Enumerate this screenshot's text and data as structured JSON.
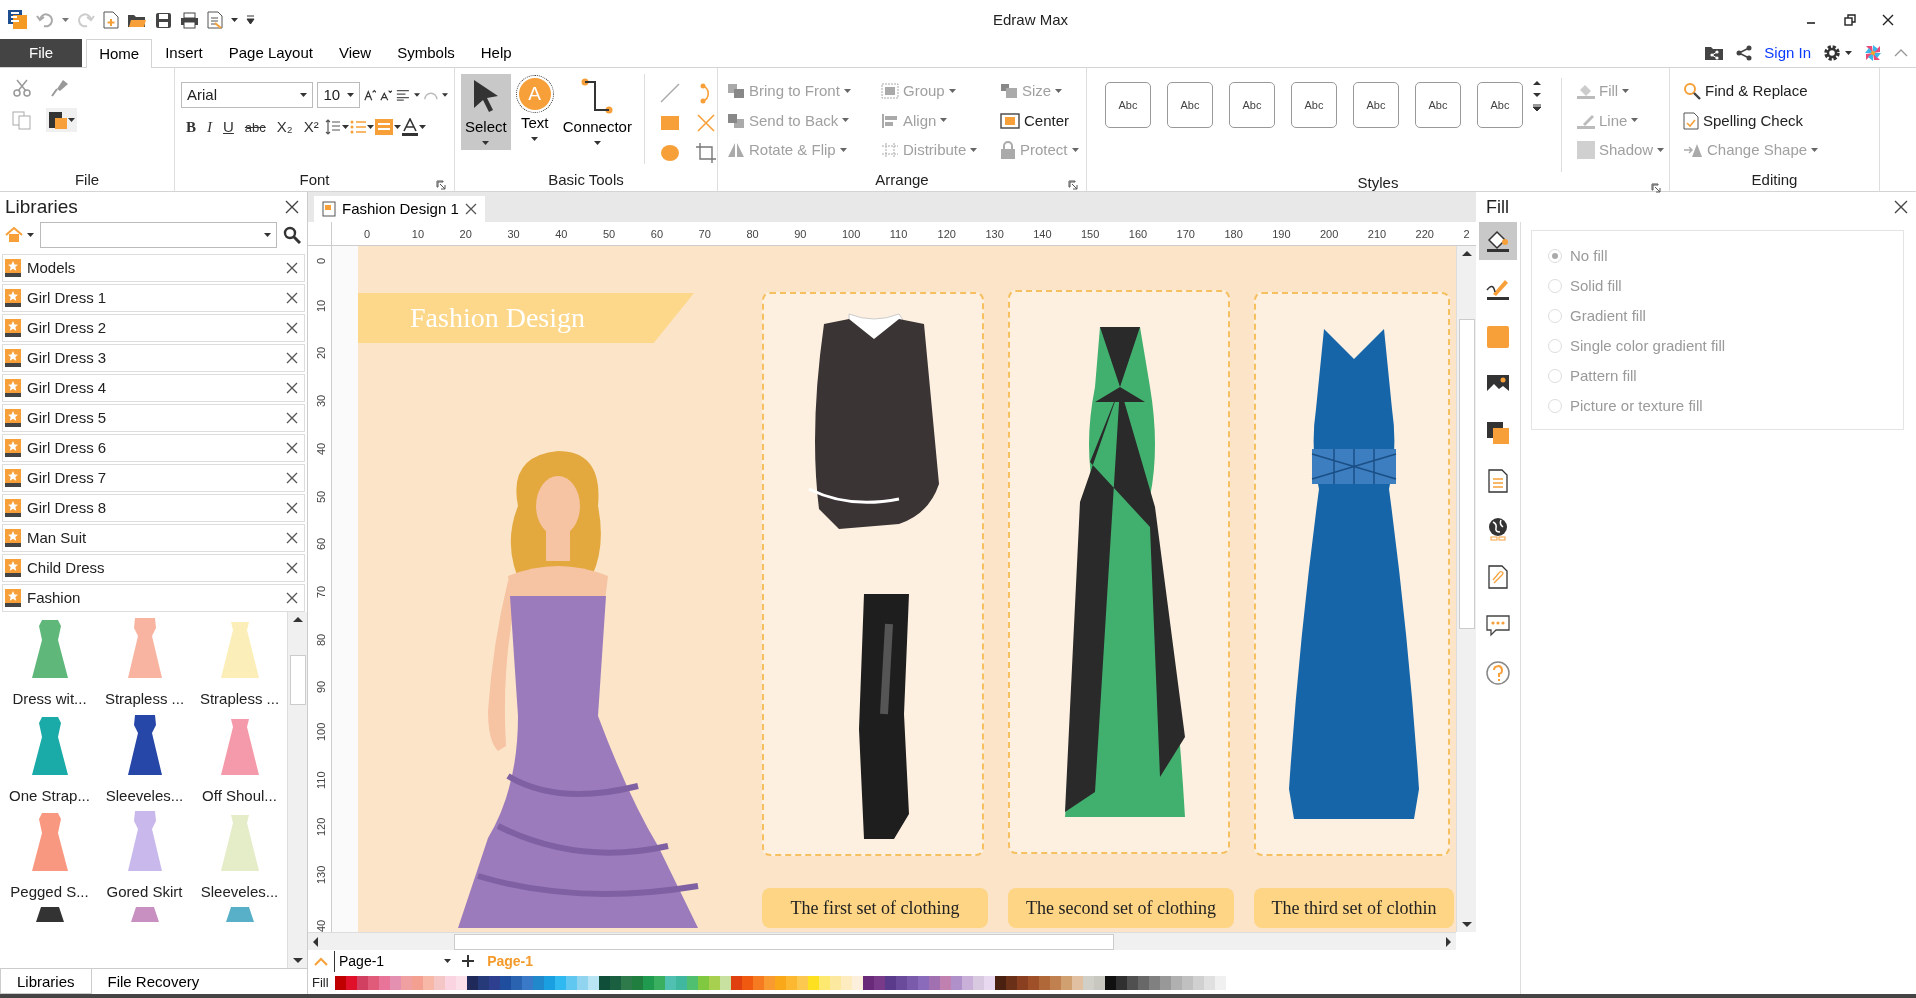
{
  "title_bar": {
    "title": "Edraw Max"
  },
  "menu_tabs": [
    {
      "label": "File",
      "kind": "file",
      "selected": false
    },
    {
      "label": "Home",
      "kind": "tab",
      "selected": true
    },
    {
      "label": "Insert",
      "kind": "tab",
      "selected": false
    },
    {
      "label": "Page Layout",
      "kind": "tab",
      "selected": false
    },
    {
      "label": "View",
      "kind": "tab",
      "selected": false
    },
    {
      "label": "Symbols",
      "kind": "tab",
      "selected": false
    },
    {
      "label": "Help",
      "kind": "tab",
      "selected": false
    }
  ],
  "account": {
    "sign_in": "Sign In"
  },
  "ribbon": {
    "file_group": {
      "label": "File"
    },
    "font_group": {
      "label": "Font",
      "font": "Arial",
      "size": "10",
      "format_buttons": [
        "B",
        "I",
        "U",
        "abc",
        "X₂",
        "X²"
      ]
    },
    "basic_tools": {
      "label": "Basic Tools",
      "tools": [
        {
          "label": "Select",
          "kind": "select",
          "selected": true
        },
        {
          "label": "Text",
          "kind": "text",
          "glyph": "A",
          "selected": false
        },
        {
          "label": "Connector",
          "kind": "connector",
          "selected": false
        }
      ]
    },
    "arrange": {
      "label": "Arrange",
      "items": [
        {
          "label": "Bring to Front",
          "kind": "front",
          "disabled": true,
          "dropdown": true
        },
        {
          "label": "Group",
          "kind": "group",
          "disabled": true,
          "dropdown": true
        },
        {
          "label": "Size",
          "kind": "size",
          "disabled": true,
          "dropdown": true
        },
        {
          "label": "Send to Back",
          "kind": "back",
          "disabled": true,
          "dropdown": true
        },
        {
          "label": "Align",
          "kind": "align",
          "disabled": true,
          "dropdown": true
        },
        {
          "label": "Center",
          "kind": "center",
          "disabled": false,
          "dropdown": false
        },
        {
          "label": "Rotate & Flip",
          "kind": "rotate",
          "disabled": true,
          "dropdown": true
        },
        {
          "label": "Distribute",
          "kind": "distribute",
          "disabled": true,
          "dropdown": true
        },
        {
          "label": "Protect",
          "kind": "protect",
          "disabled": true,
          "dropdown": true
        }
      ]
    },
    "styles": {
      "label": "Styles",
      "swatches": [
        "Abc",
        "Abc",
        "Abc",
        "Abc",
        "Abc",
        "Abc",
        "Abc"
      ],
      "format": [
        {
          "label": "Fill",
          "kind": "fill",
          "disabled": true
        },
        {
          "label": "Line",
          "kind": "line",
          "disabled": true
        },
        {
          "label": "Shadow",
          "kind": "shadow",
          "disabled": true
        }
      ]
    },
    "editing": {
      "label": "Editing",
      "items": [
        {
          "label": "Find & Replace",
          "kind": "find",
          "disabled": false,
          "dropdown": false
        },
        {
          "label": "Spelling Check",
          "kind": "spelling",
          "disabled": false,
          "dropdown": false
        },
        {
          "label": "Change Shape",
          "kind": "shape",
          "disabled": true,
          "dropdown": true
        }
      ]
    }
  },
  "libraries": {
    "title": "Libraries",
    "items": [
      {
        "label": "Models"
      },
      {
        "label": "Girl Dress 1"
      },
      {
        "label": "Girl Dress 2"
      },
      {
        "label": "Girl Dress 3"
      },
      {
        "label": "Girl Dress 4"
      },
      {
        "label": "Girl Dress 5"
      },
      {
        "label": "Girl Dress 6"
      },
      {
        "label": "Girl Dress 7"
      },
      {
        "label": "Girl Dress 8"
      },
      {
        "label": "Man Suit"
      },
      {
        "label": "Child Dress"
      },
      {
        "label": "Fashion"
      }
    ],
    "shapes": [
      {
        "label": "Dress wit..."
      },
      {
        "label": "Strapless ..."
      },
      {
        "label": "Strapless ..."
      },
      {
        "label": "One Strap..."
      },
      {
        "label": "Sleeveles..."
      },
      {
        "label": "Off Shoul..."
      },
      {
        "label": "Pegged S..."
      },
      {
        "label": "Gored Skirt"
      },
      {
        "label": "Sleeveles..."
      }
    ],
    "tabs": [
      {
        "label": "Libraries",
        "selected": true
      },
      {
        "label": "File Recovery",
        "selected": false
      }
    ]
  },
  "document_tab": {
    "title": "Fashion Design 1"
  },
  "rulers": {
    "horizontal": [
      "0",
      "10",
      "20",
      "30",
      "40",
      "50",
      "60",
      "70",
      "80",
      "90",
      "100",
      "110",
      "120",
      "130",
      "140",
      "150",
      "160",
      "170",
      "180",
      "190",
      "200",
      "210",
      "220",
      "2"
    ],
    "vertical": [
      "0",
      "10",
      "20",
      "30",
      "40",
      "50",
      "60",
      "70",
      "80",
      "90",
      "100",
      "110",
      "120",
      "130",
      "40"
    ]
  },
  "canvas": {
    "banner": "Fashion Design",
    "cards": [
      {
        "kind": "top-and-boots",
        "caption": "The first set of clothing"
      },
      {
        "kind": "striped-gown",
        "caption": "The second set of clothing"
      },
      {
        "kind": "blue-gown",
        "caption": "The third set of clothin"
      }
    ]
  },
  "page_bar": {
    "page_select": "Page-1",
    "pages": [
      {
        "label": "Page-1",
        "selected": true
      }
    ]
  },
  "palette": {
    "label": "Fill",
    "swatches": [
      {
        "color": "#c00000"
      },
      {
        "color": "#e0102a"
      },
      {
        "color": "#d14060"
      },
      {
        "color": "#e05a7a"
      },
      {
        "color": "#e8749a"
      },
      {
        "color": "#e490b0"
      },
      {
        "color": "#f0a0a0"
      },
      {
        "color": "#f4a090"
      },
      {
        "color": "#f8b8a8"
      },
      {
        "color": "#f5c6c6"
      },
      {
        "color": "#fad4e0"
      },
      {
        "color": "#fbe0ea"
      },
      {
        "color": "#1f2a5a"
      },
      {
        "color": "#263a7a"
      },
      {
        "color": "#2f3f8f"
      },
      {
        "color": "#1f4e9f"
      },
      {
        "color": "#2a64b0"
      },
      {
        "color": "#3a78c8"
      },
      {
        "color": "#2288cc"
      },
      {
        "color": "#1aa0e0"
      },
      {
        "color": "#30b8f0"
      },
      {
        "color": "#60c8f0"
      },
      {
        "color": "#90d4f0"
      },
      {
        "color": "#b8e4f4"
      },
      {
        "color": "#0f4f3a"
      },
      {
        "color": "#1a5f40"
      },
      {
        "color": "#2e7a4a"
      },
      {
        "color": "#207f3f"
      },
      {
        "color": "#1f9a4f"
      },
      {
        "color": "#3aaf60"
      },
      {
        "color": "#50c0b0"
      },
      {
        "color": "#40b8a0"
      },
      {
        "color": "#50c070"
      },
      {
        "color": "#80c840"
      },
      {
        "color": "#a8d050"
      },
      {
        "color": "#c8e0a0"
      },
      {
        "color": "#e04010"
      },
      {
        "color": "#f05a10"
      },
      {
        "color": "#f57a20"
      },
      {
        "color": "#f89a30"
      },
      {
        "color": "#f8a818"
      },
      {
        "color": "#fbb830"
      },
      {
        "color": "#fcc850"
      },
      {
        "color": "#fde020"
      },
      {
        "color": "#fde870"
      },
      {
        "color": "#fde8a0"
      },
      {
        "color": "#fdecc0"
      },
      {
        "color": "#fcf0dc"
      },
      {
        "color": "#6a2a7a"
      },
      {
        "color": "#7a3a8a"
      },
      {
        "color": "#5a3a8a"
      },
      {
        "color": "#6a4a9a"
      },
      {
        "color": "#7a5aaa"
      },
      {
        "color": "#8a6aba"
      },
      {
        "color": "#a070b0"
      },
      {
        "color": "#c080b0"
      },
      {
        "color": "#b090c8"
      },
      {
        "color": "#c8b0d8"
      },
      {
        "color": "#d8c8e0"
      },
      {
        "color": "#e8d8f0"
      },
      {
        "color": "#4a2010"
      },
      {
        "color": "#6a3018"
      },
      {
        "color": "#8a4020"
      },
      {
        "color": "#a05028"
      },
      {
        "color": "#b06838"
      },
      {
        "color": "#c08050"
      },
      {
        "color": "#d0a070"
      },
      {
        "color": "#e0c0a0"
      },
      {
        "color": "#d0d0c8"
      },
      {
        "color": "#c8c8c0"
      },
      {
        "color": "#101010"
      },
      {
        "color": "#303030"
      },
      {
        "color": "#505050"
      },
      {
        "color": "#686868"
      },
      {
        "color": "#808080"
      },
      {
        "color": "#989898"
      },
      {
        "color": "#b0b0b0"
      },
      {
        "color": "#c0c0c0"
      },
      {
        "color": "#d0d0d0"
      },
      {
        "color": "#e0e0e0"
      },
      {
        "color": "#f0f0f0"
      }
    ]
  },
  "fill_panel": {
    "title": "Fill",
    "disabled": true,
    "options": [
      {
        "label": "No fill",
        "selected": true
      },
      {
        "label": "Solid fill",
        "selected": false
      },
      {
        "label": "Gradient fill",
        "selected": false
      },
      {
        "label": "Single color gradient fill",
        "selected": false
      },
      {
        "label": "Pattern fill",
        "selected": false
      },
      {
        "label": "Picture or texture fill",
        "selected": false
      }
    ]
  }
}
